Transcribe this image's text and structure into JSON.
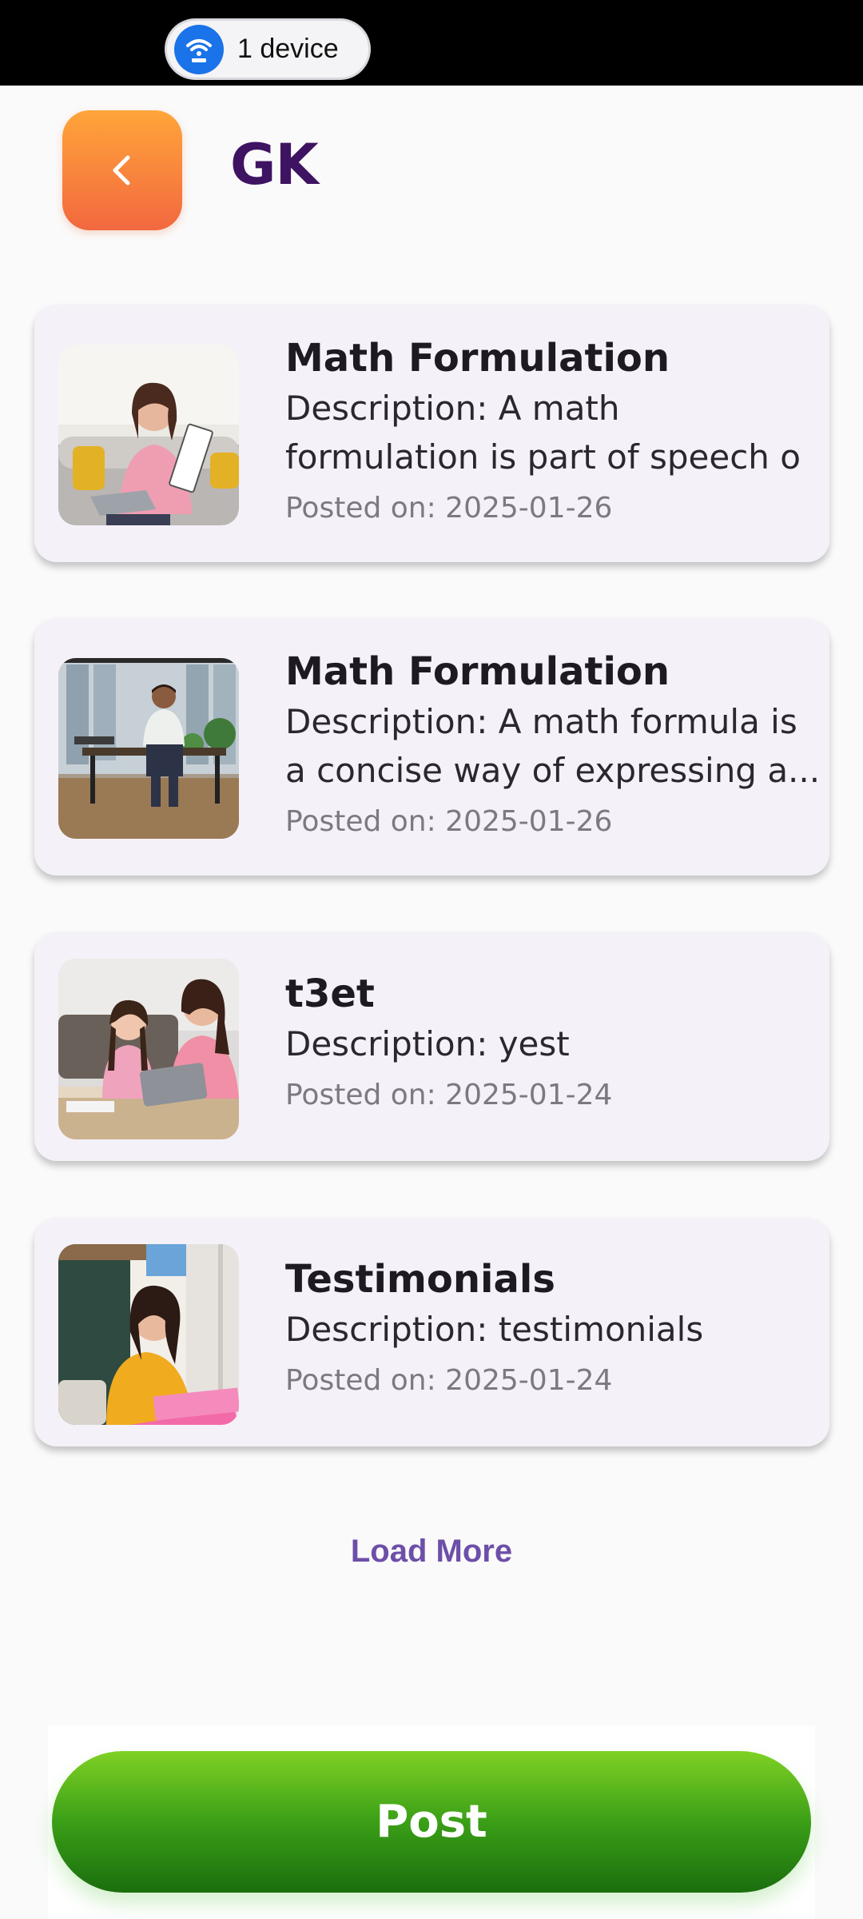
{
  "status": {
    "devices_label": "1 device"
  },
  "header": {
    "title": "GK",
    "back_icon": "chevron-left-icon"
  },
  "posts": [
    {
      "title": "Math Formulation",
      "description": "Description: A math formulation is part of speech o",
      "date": "Posted on: 2025-01-26"
    },
    {
      "title": "Math Formulation",
      "description": "Description: A math formula is a concise way of expressing a...",
      "date": "Posted on: 2025-01-26"
    },
    {
      "title": "t3et",
      "description": "Description: yest",
      "date": "Posted on: 2025-01-24"
    },
    {
      "title": "Testimonials",
      "description": "Description: testimonials",
      "date": "Posted on: 2025-01-24"
    }
  ],
  "load_more_label": "Load More",
  "post_button_label": "Post",
  "colors": {
    "accent": "#6d4fa8",
    "title": "#3e1361",
    "post_green": "#3b9f17",
    "back_orange": "#f58a3c"
  }
}
